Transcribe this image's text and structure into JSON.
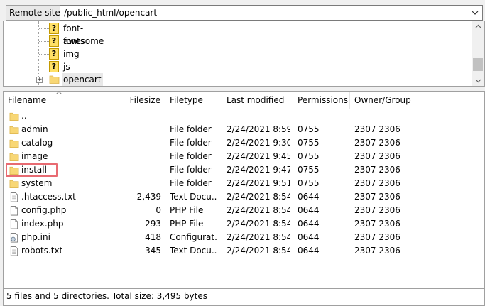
{
  "remote": {
    "label": "Remote site:",
    "path": "/public_html/opencart"
  },
  "tree": {
    "items": [
      {
        "label": "font-awesome",
        "icon": "question-folder-icon"
      },
      {
        "label": "fonts",
        "icon": "question-folder-icon"
      },
      {
        "label": "img",
        "icon": "question-folder-icon"
      },
      {
        "label": "js",
        "icon": "question-folder-icon"
      },
      {
        "label": "opencart",
        "icon": "folder-icon",
        "expander": "+"
      }
    ]
  },
  "columns": {
    "filename": "Filename",
    "filesize": "Filesize",
    "filetype": "Filetype",
    "modified": "Last modified",
    "permissions": "Permissions",
    "owner": "Owner/Group"
  },
  "files": [
    {
      "name": "..",
      "size": "",
      "type": "",
      "modified": "",
      "perms": "",
      "owner": "",
      "icon": "folder-icon"
    },
    {
      "name": "admin",
      "size": "",
      "type": "File folder",
      "modified": "2/24/2021 8:59:...",
      "perms": "0755",
      "owner": "2307 2306",
      "icon": "folder-icon"
    },
    {
      "name": "catalog",
      "size": "",
      "type": "File folder",
      "modified": "2/24/2021 9:30:...",
      "perms": "0755",
      "owner": "2307 2306",
      "icon": "folder-icon"
    },
    {
      "name": "image",
      "size": "",
      "type": "File folder",
      "modified": "2/24/2021 9:45:...",
      "perms": "0755",
      "owner": "2307 2306",
      "icon": "folder-icon"
    },
    {
      "name": "install",
      "size": "",
      "type": "File folder",
      "modified": "2/24/2021 9:47:...",
      "perms": "0755",
      "owner": "2307 2306",
      "icon": "folder-icon"
    },
    {
      "name": "system",
      "size": "",
      "type": "File folder",
      "modified": "2/24/2021 9:51:...",
      "perms": "0755",
      "owner": "2307 2306",
      "icon": "folder-icon"
    },
    {
      "name": ".htaccess.txt",
      "size": "2,439",
      "type": "Text Docu...",
      "modified": "2/24/2021 8:54:...",
      "perms": "0644",
      "owner": "2307 2306",
      "icon": "text-file-icon"
    },
    {
      "name": "config.php",
      "size": "0",
      "type": "PHP File",
      "modified": "2/24/2021 8:54:...",
      "perms": "0644",
      "owner": "2307 2306",
      "icon": "blank-file-icon"
    },
    {
      "name": "index.php",
      "size": "293",
      "type": "PHP File",
      "modified": "2/24/2021 8:54:...",
      "perms": "0644",
      "owner": "2307 2306",
      "icon": "blank-file-icon"
    },
    {
      "name": "php.ini",
      "size": "418",
      "type": "Configurat...",
      "modified": "2/24/2021 8:54:...",
      "perms": "0644",
      "owner": "2307 2306",
      "icon": "config-file-icon"
    },
    {
      "name": "robots.txt",
      "size": "345",
      "type": "Text Docu...",
      "modified": "2/24/2021 8:54:...",
      "perms": "0644",
      "owner": "2307 2306",
      "icon": "text-file-icon"
    }
  ],
  "status": "5 files and 5 directories. Total size: 3,495 bytes",
  "colors": {
    "folder": "#f8d775",
    "folder_border": "#dcb44c",
    "highlight": "#e86b72"
  }
}
